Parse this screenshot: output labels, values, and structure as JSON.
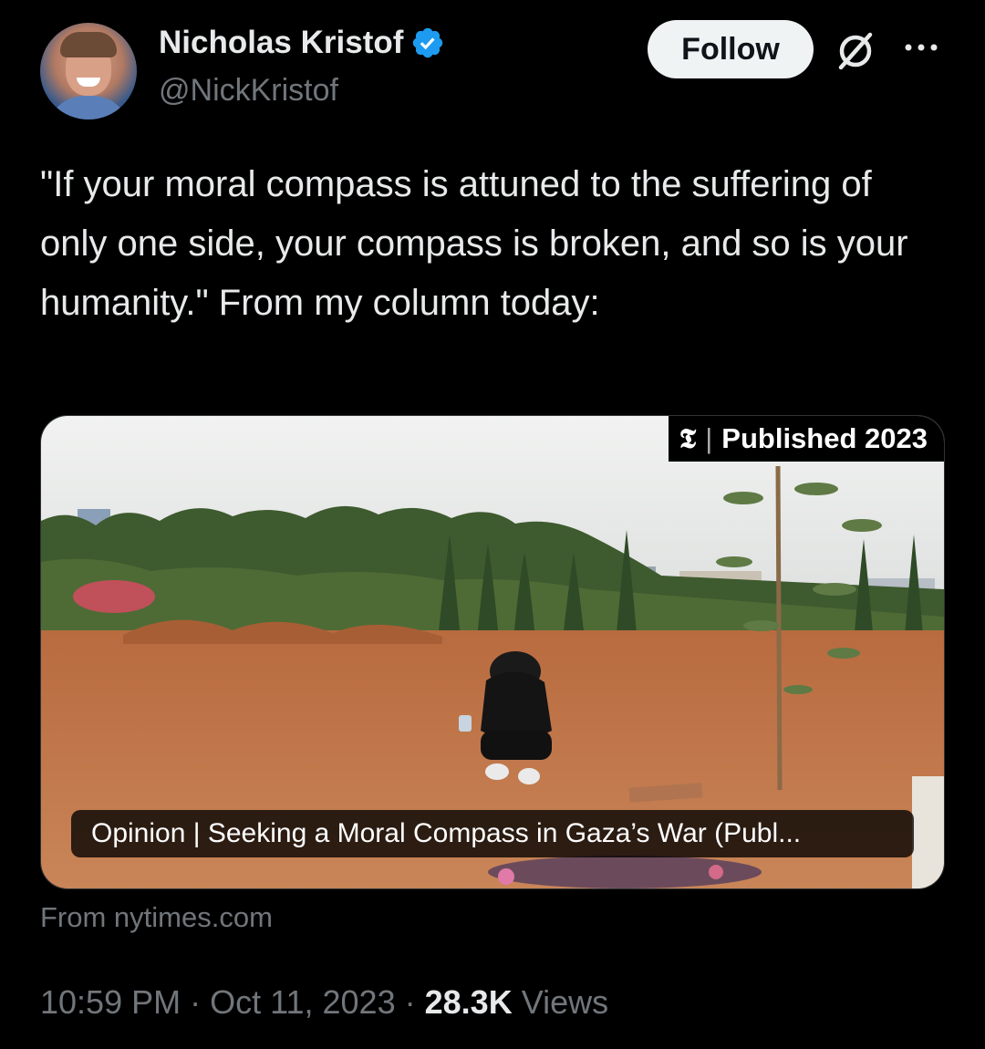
{
  "author": {
    "name": "Nicholas Kristof",
    "handle": "@NickKristof"
  },
  "header": {
    "follow_label": "Follow"
  },
  "tweet": {
    "text": "\"If your moral compass is attuned to the suffering of only one side, your compass is broken, and so is your humanity.\" From my column today:"
  },
  "card": {
    "badge_label": "Published 2023",
    "title": "Opinion | Seeking a Moral Compass in Gaza’s War (Publ...",
    "source": "From nytimes.com"
  },
  "meta": {
    "time": "10:59 PM",
    "separator": "·",
    "date": "Oct 11, 2023",
    "views_count": "28.3K",
    "views_label": "Views"
  },
  "colors": {
    "background": "#000000",
    "text": "#e7e9ea",
    "muted": "#71767b",
    "verified": "#1d9bf0",
    "follow_bg": "#eff3f4"
  },
  "icons": [
    "verified-badge-icon",
    "grok-icon",
    "more-options-icon",
    "nyt-logo-icon"
  ]
}
